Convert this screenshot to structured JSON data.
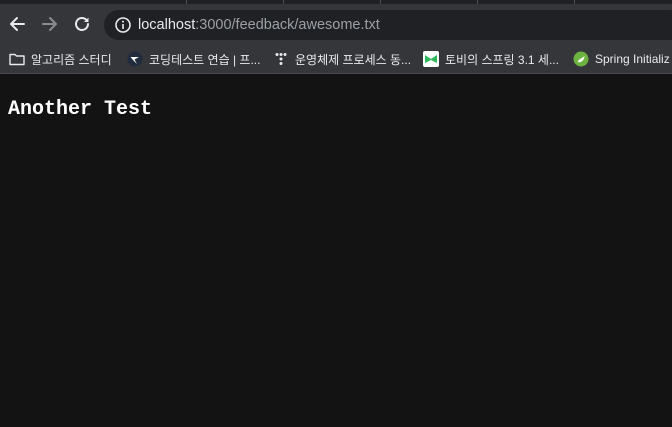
{
  "toolbar": {
    "back_icon": "arrow-left-icon",
    "forward_icon": "arrow-right-icon",
    "reload_icon": "reload-icon",
    "site_info_icon": "info-icon",
    "url_host": "localhost",
    "url_path": ":3000/feedback/awesome.txt"
  },
  "bookmarks": [
    {
      "label": "알고리즘 스터디",
      "icon": "folder-icon"
    },
    {
      "label": "코딩테스트 연습 | 프...",
      "icon": "programmers-icon"
    },
    {
      "label": "운영체제 프로세스 동...",
      "icon": "tistory-icon"
    },
    {
      "label": "토비의 스프링 3.1 세...",
      "icon": "bookmark-favicon-icon"
    },
    {
      "label": "Spring Initializ",
      "icon": "spring-icon"
    }
  ],
  "content": {
    "text": "Another Test"
  },
  "colors": {
    "page_background": "#131313",
    "toolbar": "#35363a",
    "omnibox": "#202124",
    "text": "#ffffff",
    "url_path": "#9aa0a6"
  }
}
